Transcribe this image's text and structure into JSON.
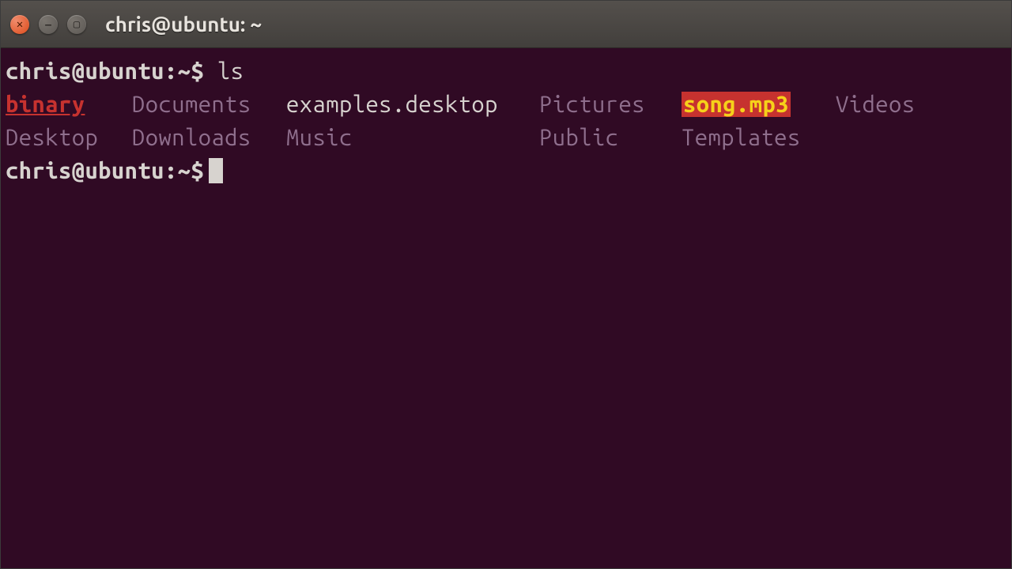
{
  "titlebar": {
    "title": "chris@ubuntu: ~",
    "close_glyph": "✕",
    "min_glyph": "—",
    "max_glyph": "▢"
  },
  "prompt1": {
    "user": "chris@ubuntu",
    "sep": ":",
    "path": "~",
    "sigil": "$",
    "command": "ls"
  },
  "listing": {
    "row1": {
      "c1": "binary",
      "c2": "Documents",
      "c3": "examples.desktop",
      "c4": "Pictures",
      "c5": "song.mp3",
      "c6": "Videos"
    },
    "row2": {
      "c1": "Desktop",
      "c2": "Downloads",
      "c3": "Music",
      "c4": "Public",
      "c5": "Templates",
      "c6": ""
    }
  },
  "prompt2": {
    "user": "chris@ubuntu",
    "sep": ":",
    "path": "~",
    "sigil": "$"
  }
}
